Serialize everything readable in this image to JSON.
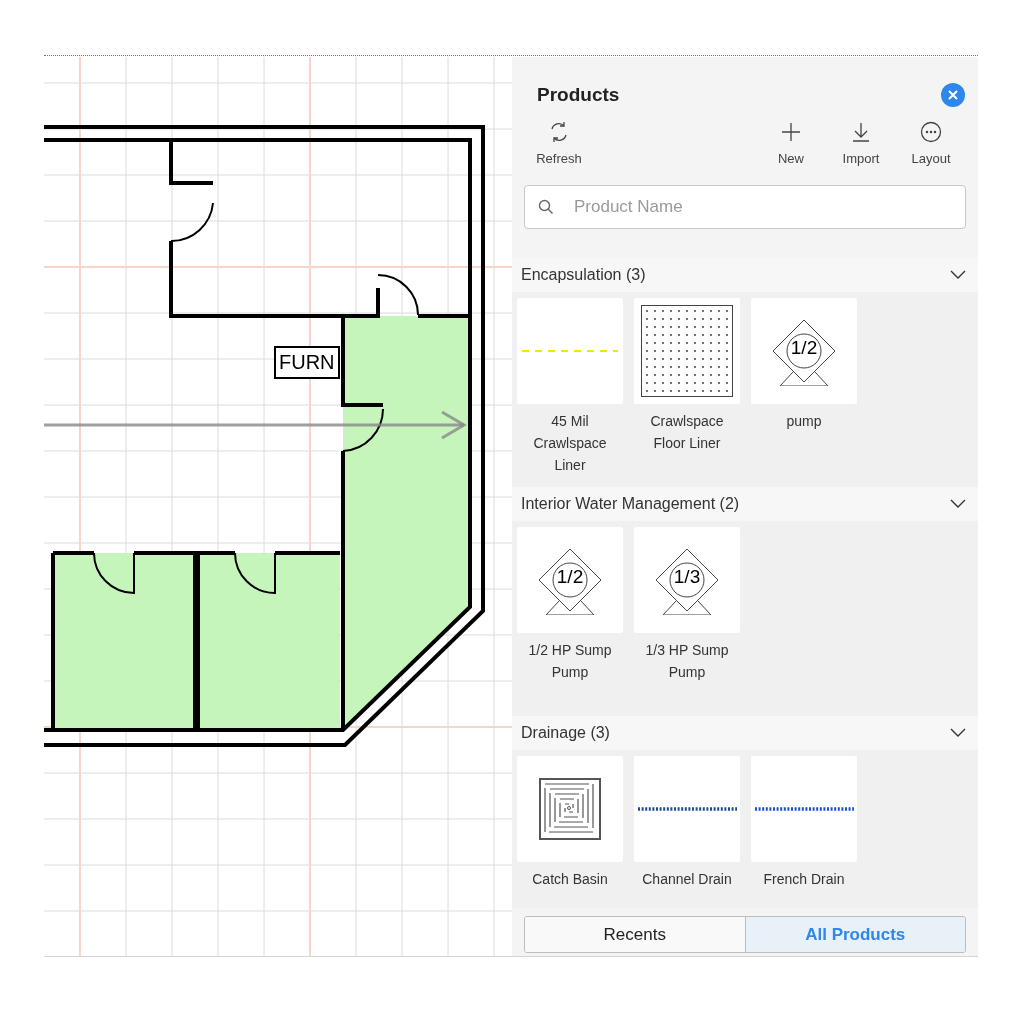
{
  "floor_plan": {
    "label": "FURN"
  },
  "panel": {
    "title": "Products",
    "toolbar": [
      {
        "kind": "refresh",
        "label": "Refresh"
      },
      {
        "kind": "new",
        "label": "New"
      },
      {
        "kind": "import",
        "label": "Import"
      },
      {
        "kind": "layout",
        "label": "Layout"
      }
    ],
    "search": {
      "placeholder": "Product Name"
    },
    "sections": [
      {
        "title": "Encapsulation (3)",
        "expanded": true,
        "items": [
          {
            "kind": "dashed-line",
            "color": "#f0e800",
            "label": "45 Mil Crawlspace Liner"
          },
          {
            "kind": "dot-pattern",
            "label": "Crawlspace Floor Liner"
          },
          {
            "kind": "pump",
            "rating": "1/2",
            "label": "pump"
          }
        ]
      },
      {
        "title": "Interior Water Management (2)",
        "expanded": true,
        "items": [
          {
            "kind": "pump",
            "rating": "1/2",
            "label": "1/2 HP Sump Pump"
          },
          {
            "kind": "pump",
            "rating": "1/3",
            "label": "1/3 HP Sump Pump"
          }
        ]
      },
      {
        "title": "Drainage (3)",
        "expanded": true,
        "items": [
          {
            "kind": "grate",
            "label": "Catch Basin"
          },
          {
            "kind": "dotted-line",
            "color": "#1f4e8c",
            "label": "Channel Drain"
          },
          {
            "kind": "dotted-line",
            "color": "#1d4fd6",
            "label": "French Drain"
          }
        ]
      }
    ],
    "tabs": [
      {
        "label": "Recents",
        "selected": false
      },
      {
        "label": "All Products",
        "selected": true
      }
    ]
  }
}
